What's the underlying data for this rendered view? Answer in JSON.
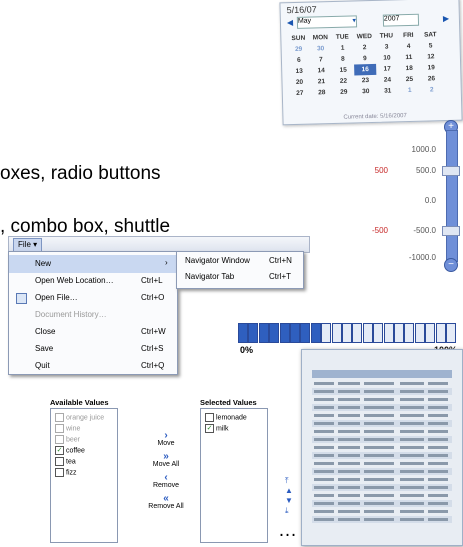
{
  "slide": {
    "line1": "oxes, radio buttons",
    "line2": ", combo box, shuttle",
    "ellipsis": "…"
  },
  "calendar": {
    "title": "5/16/07",
    "month": "May",
    "year": "2007",
    "weekdays": [
      "SUN",
      "MON",
      "TUE",
      "WED",
      "THU",
      "FRI",
      "SAT"
    ],
    "weeks": [
      [
        "29",
        "30",
        "1",
        "2",
        "3",
        "4",
        "5"
      ],
      [
        "6",
        "7",
        "8",
        "9",
        "10",
        "11",
        "12"
      ],
      [
        "13",
        "14",
        "15",
        "16",
        "17",
        "18",
        "19"
      ],
      [
        "20",
        "21",
        "22",
        "23",
        "24",
        "25",
        "26"
      ],
      [
        "27",
        "28",
        "29",
        "30",
        "31",
        "1",
        "2"
      ]
    ],
    "selected_day": "16",
    "footer": "Current date: 5/16/2007"
  },
  "slider": {
    "top_label": "1000.0",
    "label_500": "500",
    "label_500_tick": "500.0",
    "label_zero": "0.0",
    "label_neg500": "-500",
    "label_neg500_tick": "-500.0",
    "bottom_label": "-1000.0",
    "plus": "+",
    "minus": "−",
    "range_high": 500,
    "range_low": -500
  },
  "progress": {
    "min_label": "0%",
    "max_label": "100%",
    "total_segments": 21,
    "filled_segments": 8,
    "fill_color": "#2f5fbf",
    "empty_color": "#e4ebf7"
  },
  "menu": {
    "file_label": "File",
    "file_arrow": "▾",
    "items": [
      {
        "label": "New",
        "shortcut": "",
        "submenu": true,
        "disabled": false,
        "highlighted": true
      },
      {
        "label": "Open Web Location…",
        "shortcut": "Ctrl+L",
        "disabled": false
      },
      {
        "label": "Open File…",
        "shortcut": "Ctrl+O",
        "disabled": false,
        "icon": true
      },
      {
        "label": "Document History…",
        "shortcut": "",
        "disabled": true
      },
      {
        "label": "Close",
        "shortcut": "Ctrl+W",
        "disabled": false
      },
      {
        "label": "Save",
        "shortcut": "Ctrl+S",
        "disabled": false
      },
      {
        "label": "Quit",
        "shortcut": "Ctrl+Q",
        "disabled": false
      }
    ],
    "submenu_arrow": "›",
    "submenu": [
      {
        "label": "Navigator Window",
        "shortcut": "Ctrl+N"
      },
      {
        "label": "Navigator Tab",
        "shortcut": "Ctrl+T"
      }
    ]
  },
  "shuttle": {
    "available_title": "Available Values",
    "selected_title": "Selected Values",
    "available": [
      {
        "label": "orange juice",
        "checked": false,
        "disabled": true
      },
      {
        "label": "wine",
        "checked": false,
        "disabled": true
      },
      {
        "label": "beer",
        "checked": false,
        "disabled": true
      },
      {
        "label": "coffee",
        "checked": true,
        "disabled": false
      },
      {
        "label": "tea",
        "checked": false,
        "disabled": false
      },
      {
        "label": "fizz",
        "checked": false,
        "disabled": false
      }
    ],
    "selected": [
      {
        "label": "lemonade",
        "checked": false
      },
      {
        "label": "milk",
        "checked": true
      }
    ],
    "move": "Move",
    "move_all": "Move All",
    "remove": "Remove",
    "remove_all": "Remove All",
    "check_mark": "✓",
    "arrow_move": "›",
    "arrow_move_all": "»",
    "arrow_remove": "‹",
    "arrow_remove_all": "«",
    "reorder_icons": [
      "⤒",
      "▲",
      "▼",
      "⤓"
    ]
  },
  "table_thumbnail": {
    "rows": 18
  }
}
